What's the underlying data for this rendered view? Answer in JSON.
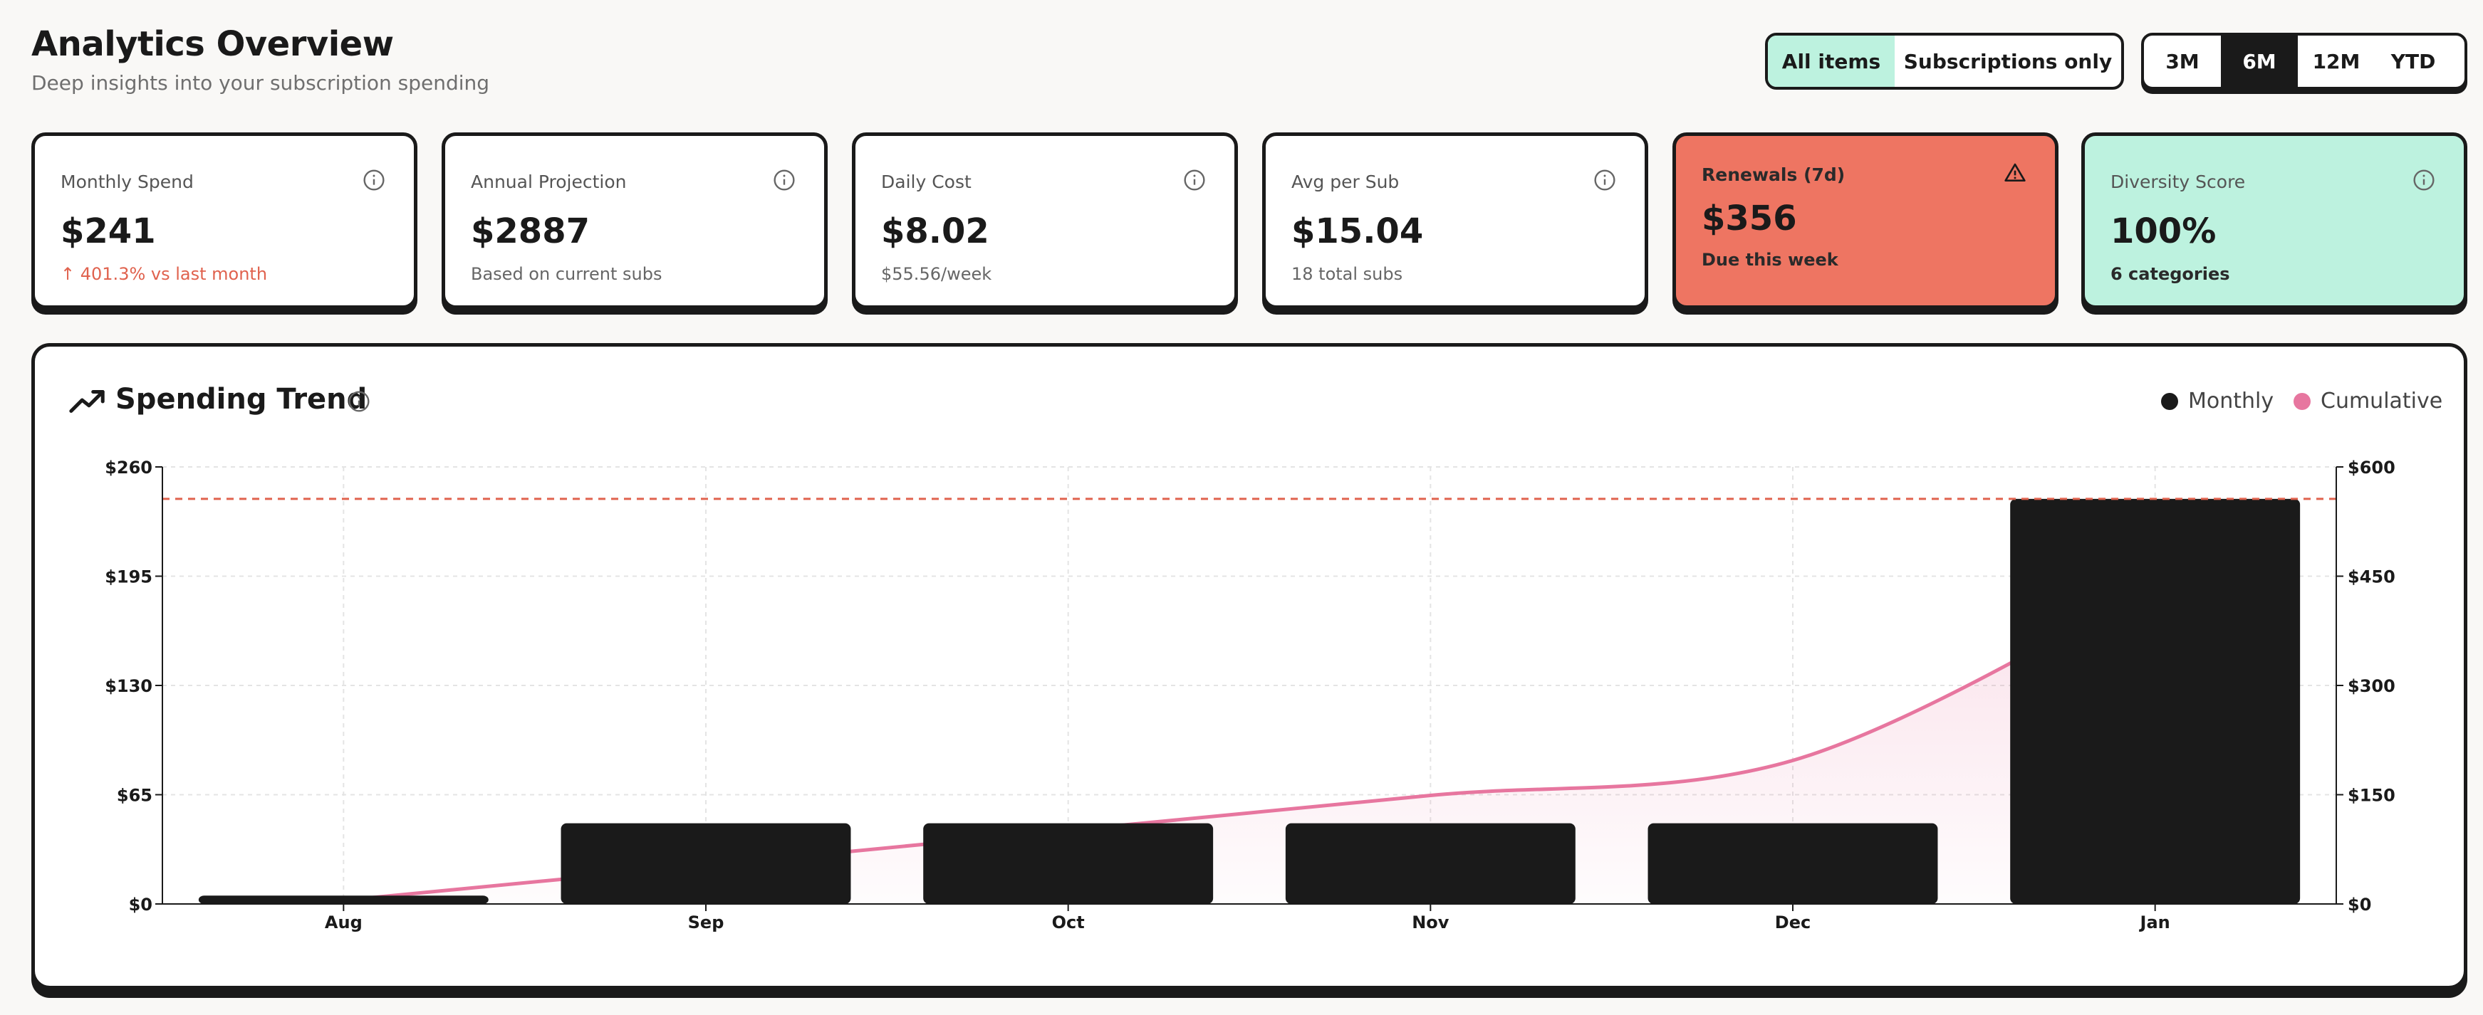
{
  "header": {
    "title": "Analytics Overview",
    "subtitle": "Deep insights into your subscription spending"
  },
  "filters": {
    "items": [
      "All items",
      "Subscriptions only"
    ],
    "items_selected": "All items",
    "ranges": [
      "3M",
      "6M",
      "12M",
      "YTD"
    ],
    "range_selected": "6M"
  },
  "cards": [
    {
      "label": "Monthly Spend",
      "value": "$241",
      "sub": "401.3% vs last month",
      "sub_arrow": "↑",
      "icon": "info-icon"
    },
    {
      "label": "Annual Projection",
      "value": "$2887",
      "sub": "Based on current subs",
      "icon": "info-icon"
    },
    {
      "label": "Daily Cost",
      "value": "$8.02",
      "sub": "$55.56/week",
      "icon": "info-icon"
    },
    {
      "label": "Avg per Sub",
      "value": "$15.04",
      "sub": "18 total subs",
      "icon": "info-icon"
    },
    {
      "label": "Renewals (7d)",
      "value": "$356",
      "sub": "Due this week",
      "icon": "warning-icon"
    },
    {
      "label": "Diversity Score",
      "value": "100%",
      "sub": "6 categories",
      "icon": "info-icon"
    }
  ],
  "colors": {
    "accent_red": "#ee7562",
    "accent_mint": "#bdf2df",
    "cumulative_pink": "#e7769f",
    "bar": "#1a1a1a"
  },
  "panel": {
    "title": "Spending Trend",
    "legend": [
      {
        "name": "Monthly",
        "color": "#1a1a1a"
      },
      {
        "name": "Cumulative",
        "color": "#e7769f"
      }
    ]
  },
  "chart_data": {
    "type": "bar",
    "categories": [
      "Aug",
      "Sep",
      "Oct",
      "Nov",
      "Dec",
      "Jan"
    ],
    "series": [
      {
        "name": "Monthly",
        "axis": "left",
        "type": "bar",
        "values": [
          5,
          48,
          48,
          48,
          48,
          241
        ]
      },
      {
        "name": "Cumulative",
        "axis": "right",
        "type": "area",
        "values": [
          5,
          53,
          101,
          149,
          197,
          438
        ]
      }
    ],
    "ylim_left": [
      0,
      260
    ],
    "yticks_left": [
      "$0",
      "$65",
      "$130",
      "$195",
      "$260"
    ],
    "ylim_right": [
      0,
      600
    ],
    "yticks_right": [
      "$0",
      "$150",
      "$300",
      "$450",
      "$600"
    ],
    "reference_line": {
      "axis": "left",
      "value": 241,
      "style": "dashed",
      "color": "#e0624e"
    },
    "grid": true
  }
}
